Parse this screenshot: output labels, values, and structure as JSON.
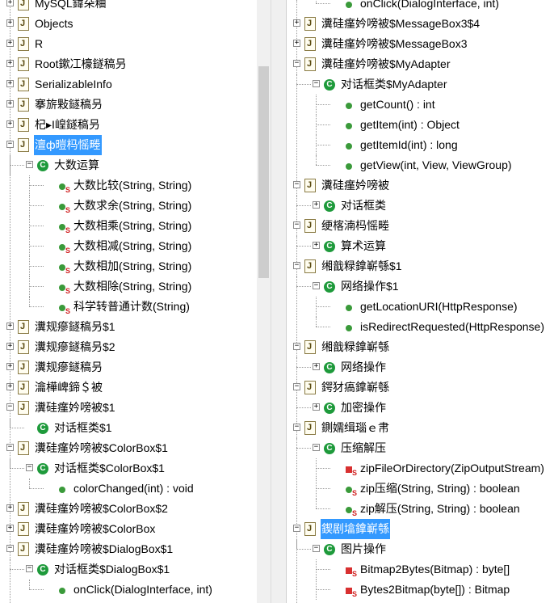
{
  "left_tree": [
    {
      "label": "MySQL鍏朵粬"
    },
    {
      "label": "Objects"
    },
    {
      "label": "R"
    },
    {
      "label": "Root鏉冮檺鐩稿叧"
    },
    {
      "label": "SerializableInfo"
    },
    {
      "label": "搴旂敤鐩稿叧"
    },
    {
      "label": "杞▸I崲鐩稿叧"
    },
    {
      "label": "澶ф暟杩愮畻"
    },
    {
      "label": "大数运算"
    },
    {
      "label": "大数比较(String, String)"
    },
    {
      "label": "大数求余(String, String)"
    },
    {
      "label": "大数相乘(String, String)"
    },
    {
      "label": "大数相减(String, String)"
    },
    {
      "label": "大数相加(String, String)"
    },
    {
      "label": "大数相除(String, String)"
    },
    {
      "label": "科学转普通计数(String)"
    },
    {
      "label": "瀵规瘮鐩稿叧$1"
    },
    {
      "label": "瀵规瘮鐩稿叧$2"
    },
    {
      "label": "瀵规瘮鐩稿叧"
    },
    {
      "label": "瀹樺崥鍗＄被"
    },
    {
      "label": "瀵硅瘽妗嗙被$1"
    },
    {
      "label": "对话框类$1"
    },
    {
      "label": "瀵硅瘽妗嗙被$ColorBox$1"
    },
    {
      "label": "对话框类$ColorBox$1"
    },
    {
      "label": "colorChanged(int) : void"
    },
    {
      "label": "瀵硅瘽妗嗙被$ColorBox$2"
    },
    {
      "label": "瀵硅瘽妗嗙被$ColorBox"
    },
    {
      "label": "瀵硅瘽妗嗙被$DialogBox$1"
    },
    {
      "label": "对话框类$DialogBox$1"
    },
    {
      "label": "onClick(DialogInterface, int)"
    }
  ],
  "right_tree": [
    {
      "label": "onClick(DialogInterface, int)"
    },
    {
      "label": "瀵硅瘽妗嗙被$MessageBox3$4"
    },
    {
      "label": "瀵硅瘽妗嗙被$MessageBox3"
    },
    {
      "label": "瀵硅瘽妗嗙被$MyAdapter"
    },
    {
      "label": "对话框类$MyAdapter"
    },
    {
      "label": "getCount() : int"
    },
    {
      "label": "getItem(int) : Object"
    },
    {
      "label": "getItemId(int) : long"
    },
    {
      "label": "getView(int, View, ViewGroup)"
    },
    {
      "label": "瀵硅瘽妗嗙被"
    },
    {
      "label": "对话框类"
    },
    {
      "label": "绠楁湳杩愮畻"
    },
    {
      "label": "算术运算"
    },
    {
      "label": "缃戠粶鎿嶄綔$1"
    },
    {
      "label": "网络操作$1"
    },
    {
      "label": "getLocationURI(HttpResponse)"
    },
    {
      "label": "isRedirectRequested(HttpResponse)"
    },
    {
      "label": "缃戠粶鎿嶄綔"
    },
    {
      "label": "网络操作"
    },
    {
      "label": "鍔犲瘑鎿嶄綔"
    },
    {
      "label": "加密操作"
    },
    {
      "label": "鍘嬬缉瑙ｅ帇"
    },
    {
      "label": "压缩解压"
    },
    {
      "label": "zipFileOrDirectory(ZipOutputStream)"
    },
    {
      "label": "zip压缩(String, String) : boolean"
    },
    {
      "label": "zip解压(String, String) : boolean"
    },
    {
      "label": "鍥剧墖鎿嶄綔"
    },
    {
      "label": "图片操作"
    },
    {
      "label": "Bitmap2Bytes(Bitmap) : byte[]"
    },
    {
      "label": "Bytes2Bitmap(byte[]) : Bitmap"
    }
  ]
}
